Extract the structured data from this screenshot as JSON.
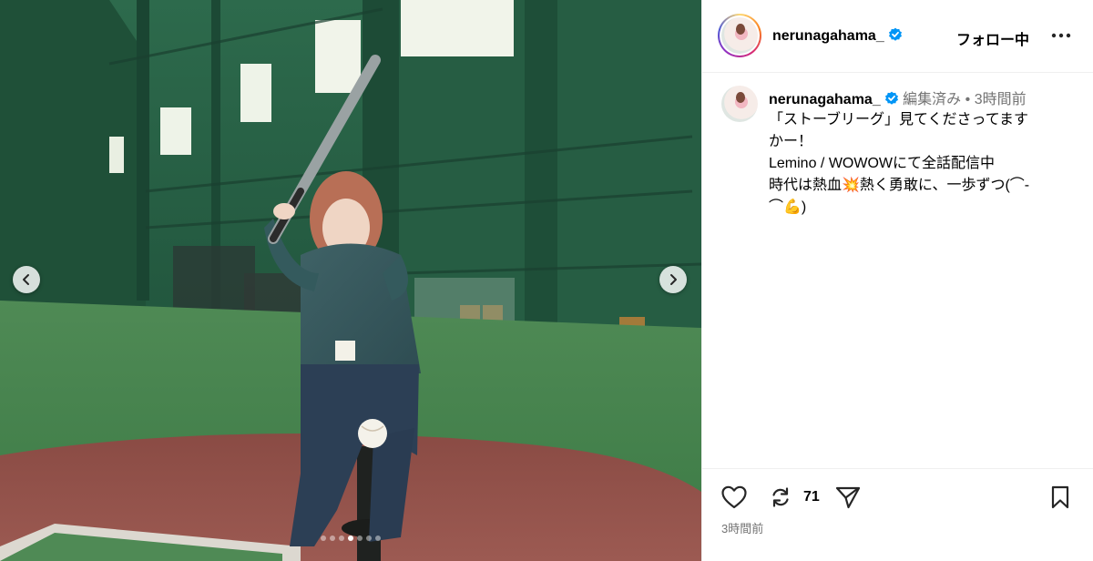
{
  "header": {
    "username": "nerunagahama_",
    "follow_label": "フォロー中",
    "more_icon": "more-horizontal-icon"
  },
  "caption": {
    "username": "nerunagahama_",
    "edited": "編集済み",
    "separator": "•",
    "time": "3時間前",
    "lines": [
      "「ストーブリーグ」見てくださってます",
      "かー！",
      "Lemino / WOWOWにて全話配信中",
      "時代は熱血💥熱く勇敢に、一歩ずつ(⌒-",
      "⌒💪)"
    ]
  },
  "actions": {
    "repost_count": "71",
    "timestamp": "3時間前"
  },
  "carousel": {
    "total": 7,
    "active_index": 3
  },
  "colors": {
    "verified": "#0095f6",
    "meta_text": "#737373"
  }
}
